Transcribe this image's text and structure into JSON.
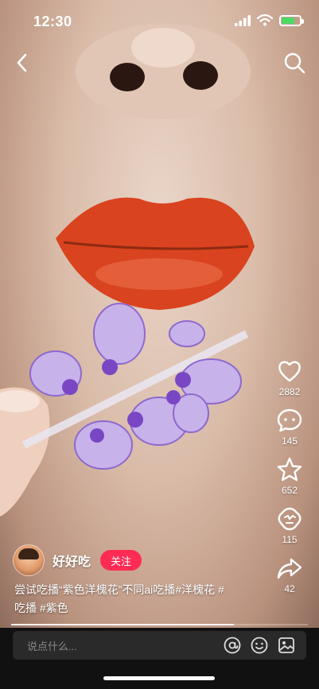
{
  "status_bar": {
    "time": "12:30"
  },
  "author": {
    "name": "好好吃",
    "follow_label": "关注"
  },
  "caption": {
    "line1": "尝试吃播“紫色洋槐花”不同ai吃播#洋槐花 #",
    "line2": "吃播 #紫色"
  },
  "actions": {
    "like_count": "2882",
    "comment_count": "145",
    "favorite_count": "652",
    "share_count": "42",
    "recommend_count": "115"
  },
  "comment_bar": {
    "placeholder": "说点什么..."
  },
  "progress": {
    "fraction": 0.75
  },
  "colors": {
    "follow": "#fe2c55",
    "battery": "#4cd964",
    "lips": "#d9431f",
    "flower": "#b9a0e6"
  },
  "icons": [
    "back-icon",
    "search-icon",
    "heart-icon",
    "comment-icon",
    "star-icon",
    "recommend-icon",
    "share-icon",
    "mention-icon",
    "emoji-icon",
    "image-icon"
  ]
}
